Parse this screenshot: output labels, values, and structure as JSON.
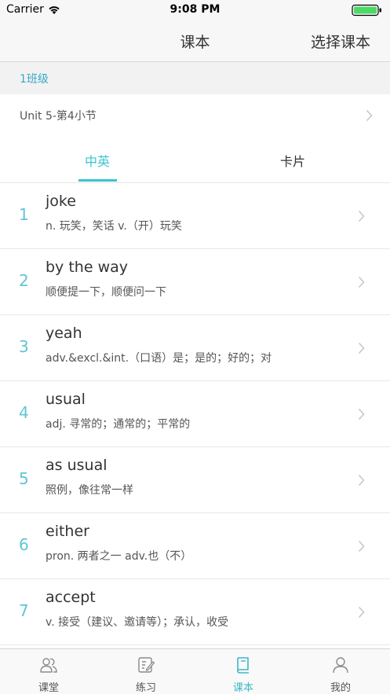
{
  "status_bar": {
    "carrier": "Carrier",
    "time": "9:08 PM"
  },
  "nav": {
    "title": "课本",
    "right_action": "选择课本"
  },
  "class_header": {
    "label": "1班级"
  },
  "unit": {
    "label": "Unit 5-第4小节"
  },
  "tabs": [
    {
      "label": "中英",
      "active": true
    },
    {
      "label": "卡片",
      "active": false
    }
  ],
  "words": [
    {
      "index": "1",
      "word": "joke",
      "definition": "n. 玩笑，笑话  v.（开）玩笑"
    },
    {
      "index": "2",
      "word": "by the way",
      "definition": "顺便提一下，顺便问一下"
    },
    {
      "index": "3",
      "word": "yeah",
      "definition": "adv.&excl.&int.（口语）是；是的；好的；对"
    },
    {
      "index": "4",
      "word": "usual",
      "definition": "adj. 寻常的；通常的；平常的"
    },
    {
      "index": "5",
      "word": "as usual",
      "definition": "照例，像往常一样"
    },
    {
      "index": "6",
      "word": "either",
      "definition": "pron. 两者之一 adv.也（不）"
    },
    {
      "index": "7",
      "word": "accept",
      "definition": "v. 接受（建议、邀请等）；承认，收受"
    }
  ],
  "tab_bar": [
    {
      "label": "课堂",
      "icon": "classroom-icon",
      "active": false
    },
    {
      "label": "练习",
      "icon": "practice-icon",
      "active": false
    },
    {
      "label": "课本",
      "icon": "textbook-icon",
      "active": true
    },
    {
      "label": "我的",
      "icon": "profile-icon",
      "active": false
    }
  ],
  "colors": {
    "accent": "#3bc4cf",
    "index_color": "#5ec6d6",
    "class_label": "#3aa8c8"
  }
}
